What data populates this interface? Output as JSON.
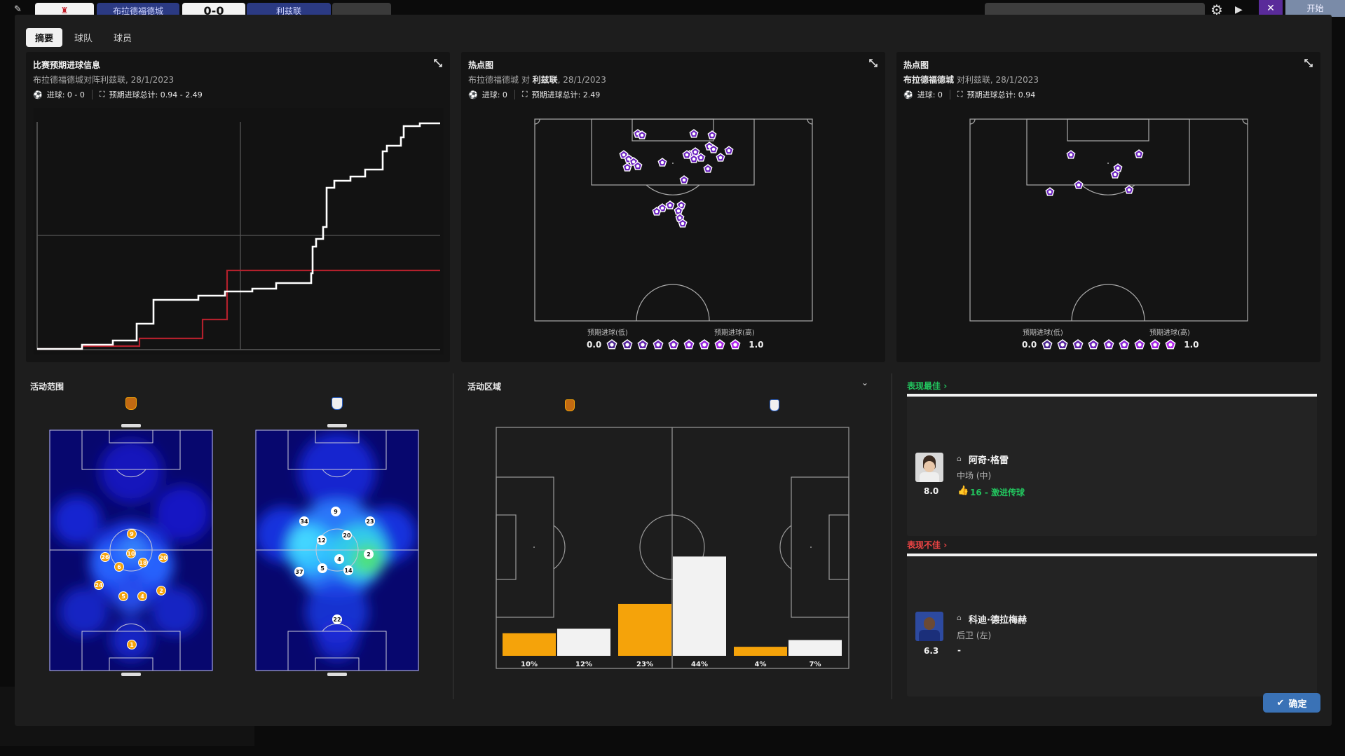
{
  "topbar": {
    "home_team": "布拉德福德城",
    "score": "0-0",
    "away_team": "利兹联",
    "right_button": "开始"
  },
  "tabs": [
    {
      "label": "摘要",
      "active": true
    },
    {
      "label": "球队",
      "active": false
    },
    {
      "label": "球员",
      "active": false
    }
  ],
  "xg_panel": {
    "title": "比赛预期进球信息",
    "subtitle": "布拉德福德城对阵利兹联, 28/1/2023",
    "goals_label": "进球: 0 - 0",
    "xg_label": "预期进球总计: 0.94 - 2.49",
    "series_colors": {
      "leeds": "#ffffff",
      "bradford": "#b3202c"
    }
  },
  "heatmap_leeds": {
    "title": "热点图",
    "subtitle_team": "布拉德福德城",
    "subtitle_mid": " 对 ",
    "subtitle_team2": "利兹联",
    "subtitle_date": ", 28/1/2023",
    "goals_label": "进球: 0",
    "xg_label": "预期进球总计: 2.49",
    "legend_low": "预期进球(低)",
    "legend_high": "预期进球(高)",
    "legend_min": "0.0",
    "legend_max": "1.0"
  },
  "heatmap_bradford": {
    "title": "热点图",
    "subtitle_team": "布拉德福德城",
    "subtitle_rest": " 对利兹联, 28/1/2023",
    "goals_label": "进球: 0",
    "xg_label": "预期进球总计: 0.94",
    "legend_low": "预期进球(低)",
    "legend_high": "预期进球(高)",
    "legend_min": "0.0",
    "legend_max": "1.0"
  },
  "activity_range": {
    "title": "活动范围",
    "bradford_players": [
      "9",
      "10",
      "18",
      "20",
      "26",
      "6",
      "24",
      "5",
      "4",
      "2",
      "1"
    ],
    "leeds_players": [
      "9",
      "34",
      "23",
      "12",
      "20",
      "2",
      "4",
      "37",
      "5",
      "14",
      "22"
    ]
  },
  "activity_zone": {
    "title": "活动区域",
    "bars": [
      {
        "team": "bradford",
        "label": "10%",
        "value": 10
      },
      {
        "team": "leeds",
        "label": "12%",
        "value": 12
      },
      {
        "team": "bradford",
        "label": "23%",
        "value": 23
      },
      {
        "team": "leeds",
        "label": "44%",
        "value": 44
      },
      {
        "team": "bradford",
        "label": "4%",
        "value": 4
      },
      {
        "team": "leeds",
        "label": "7%",
        "value": 7
      }
    ],
    "colors": {
      "bradford": "#f5a30a",
      "leeds": "#f2f2f2"
    }
  },
  "best": {
    "title": "表现最佳",
    "player_name": "阿奇·格雷",
    "position": "中场 (中)",
    "rating": "8.0",
    "highlight": "16 - 激进传球",
    "color": "#22c55e"
  },
  "worst": {
    "title": "表现不佳",
    "player_name": "科迪·德拉梅赫",
    "position": "后卫 (左)",
    "rating": "6.3",
    "highlight": "-",
    "color": "#ef4444"
  },
  "confirm_label": "确定"
}
